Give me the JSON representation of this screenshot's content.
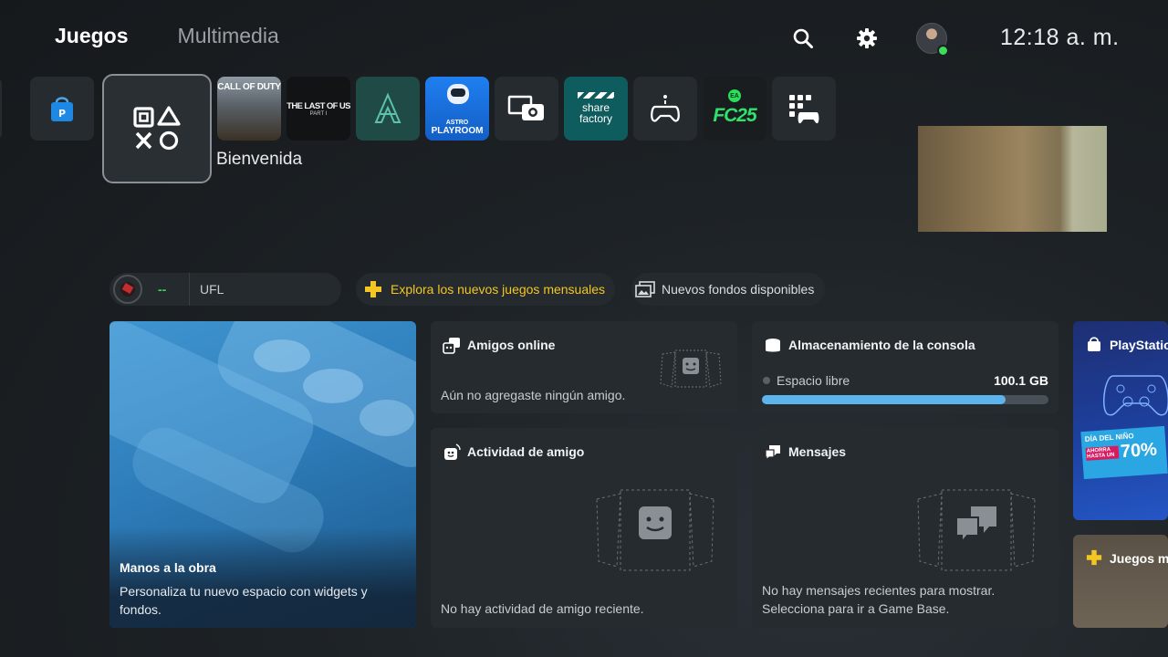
{
  "nav": {
    "tabs": [
      {
        "label": "Juegos"
      },
      {
        "label": "Multimedia"
      }
    ]
  },
  "header": {
    "clock": "12:18 a. m."
  },
  "game_row": {
    "welcome_label": "Bienvenida",
    "tiles": [
      {
        "label": "CALL OF DUTY"
      },
      {
        "label": "THE LAST OF US",
        "sub": "PART I"
      },
      {
        "label": "ASTRO",
        "sub": "PLAYROOM"
      },
      {
        "label": "share",
        "sub": "factory"
      },
      {
        "label": "FC25",
        "badge": "EA"
      }
    ]
  },
  "pills": {
    "trophy_value": "--",
    "trophy_game": "UFL",
    "monthly_games": "Explora los nuevos juegos mensuales",
    "wallpapers": "Nuevos fondos disponibles"
  },
  "cards": {
    "hero": {
      "title": "Manos a la obra",
      "body": "Personaliza tu nuevo espacio con widgets y fondos."
    },
    "friends_online": {
      "title": "Amigos online",
      "body": "Aún no agregaste ningún amigo."
    },
    "storage": {
      "title": "Almacenamiento de la consola",
      "label": "Espacio libre",
      "value": "100.1 GB",
      "fill_fraction": 0.85
    },
    "friend_activity": {
      "title": "Actividad de amigo",
      "body": "No hay actividad de amigo reciente."
    },
    "messages": {
      "title": "Mensajes",
      "body": "No hay mensajes recientes para mostrar. Selecciona para ir a Game Base."
    },
    "store": {
      "title": "PlayStatio",
      "banner_line1": "DÍA DEL NIÑO",
      "banner_line2": "AHORRA HASTA UN",
      "banner_pct": "70%"
    },
    "plus": {
      "title": "Juegos me"
    }
  },
  "colors": {
    "accent_blue": "#5db3ec",
    "plus_yellow": "#f3c623",
    "online_green": "#3ddc5a"
  }
}
